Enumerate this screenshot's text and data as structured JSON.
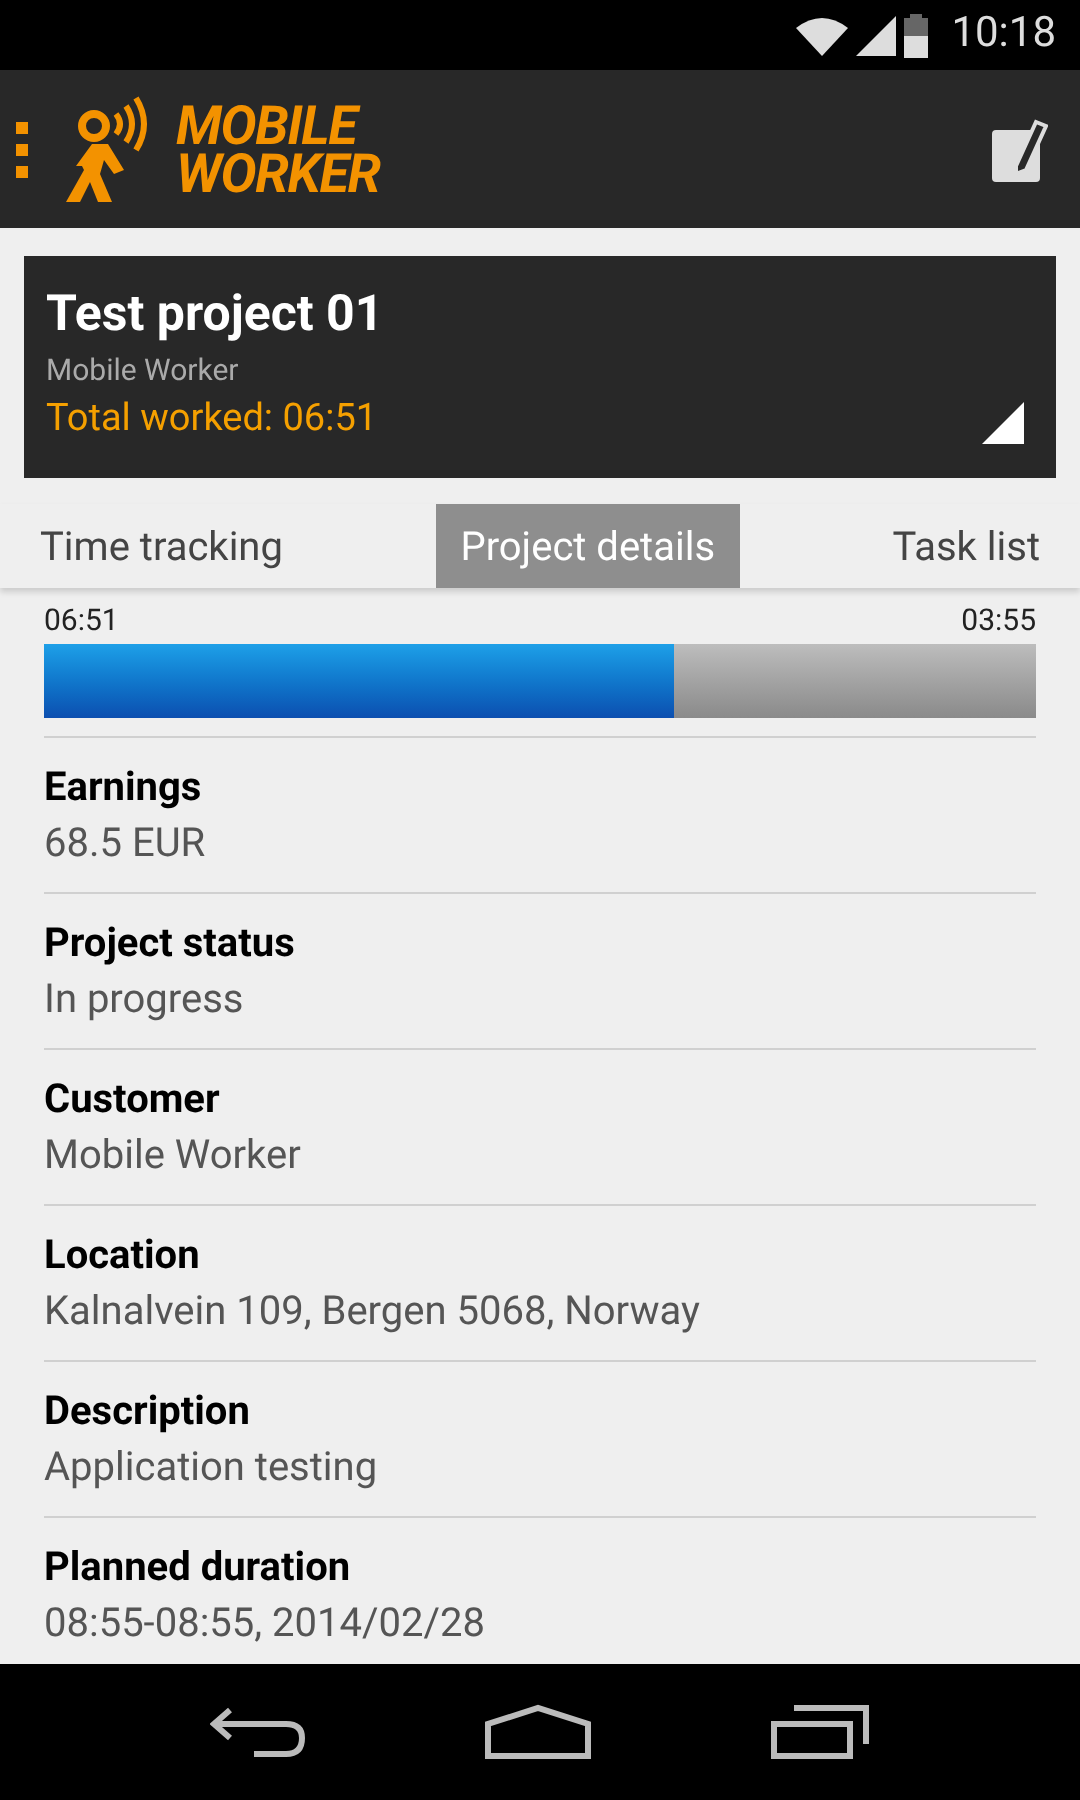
{
  "status_bar": {
    "time": "10:18"
  },
  "app_bar": {
    "logo_line_1": "MOBILE",
    "logo_line_2": "WORKER"
  },
  "project": {
    "title": "Test project 01",
    "client": "Mobile Worker",
    "total": "Total worked: 06:51"
  },
  "tabs": [
    {
      "label": "Time tracking",
      "selected": false
    },
    {
      "label": "Project details",
      "selected": true
    },
    {
      "label": "Task list",
      "selected": false
    }
  ],
  "progress": {
    "left": "06:51",
    "right": "03:55",
    "level": 0.636
  },
  "details": [
    {
      "label": "Earnings",
      "value": "68.5 EUR"
    },
    {
      "label": "Project status",
      "value": "In progress"
    },
    {
      "label": "Customer",
      "value": "Mobile Worker"
    },
    {
      "label": "Location",
      "value": "Kalnalvein 109, Bergen 5068, Norway"
    },
    {
      "label": "Description",
      "value": "Application testing"
    },
    {
      "label": "Planned duration",
      "value": "08:55-08:55, 2014/02/28"
    }
  ]
}
